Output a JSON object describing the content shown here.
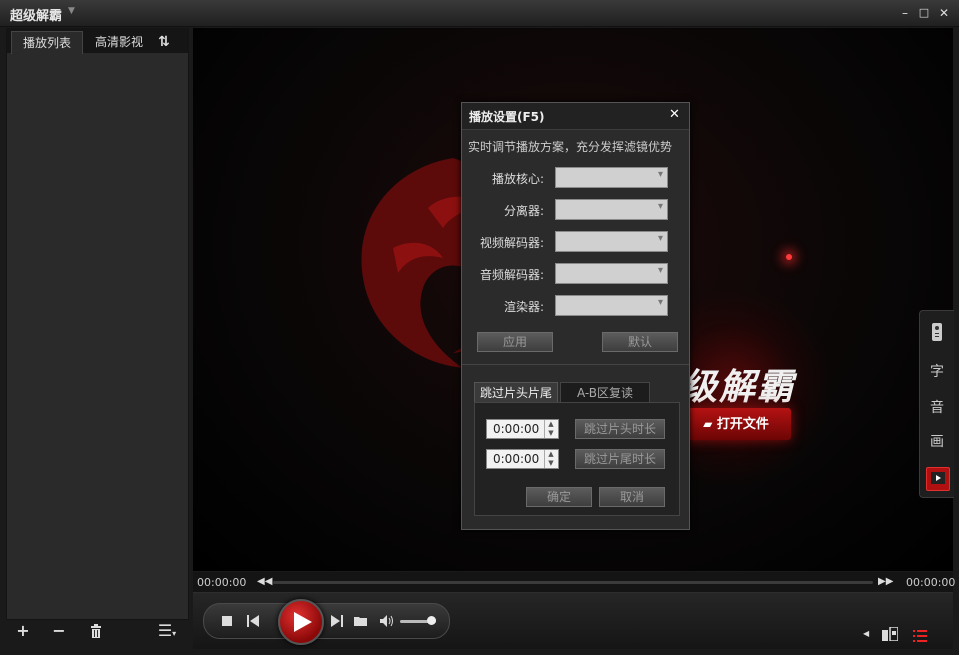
{
  "app": {
    "title": "超级解霸"
  },
  "window": {
    "minimize": "–",
    "maximize": "□",
    "close": "✕"
  },
  "sidebar": {
    "tabs": [
      {
        "label": "播放列表"
      },
      {
        "label": "高清影视"
      }
    ],
    "refresh_icon": "refresh-icon",
    "bottom": {
      "add": "+",
      "remove": "−",
      "delete_icon": "trash-icon",
      "menu": "☰"
    }
  },
  "video": {
    "brand_text": "级解霸",
    "open_file_label": "打开文件"
  },
  "right_rail": {
    "items": [
      {
        "name": "remote-icon",
        "label": ""
      },
      {
        "name": "subtitle",
        "label": "字"
      },
      {
        "name": "audio",
        "label": "音"
      },
      {
        "name": "screen",
        "label": "画"
      },
      {
        "name": "play-media-icon",
        "label": ""
      }
    ]
  },
  "dialog": {
    "title": "播放设置(F5)",
    "description": "实时调节播放方案，充分发挥滤镜优势",
    "fields": [
      {
        "label": "播放核心:",
        "value": ""
      },
      {
        "label": "分离器:",
        "value": ""
      },
      {
        "label": "视频解码器:",
        "value": ""
      },
      {
        "label": "音频解码器:",
        "value": ""
      },
      {
        "label": "渲染器:",
        "value": ""
      }
    ],
    "apply_label": "应用",
    "default_label": "默认",
    "tabs": [
      {
        "label": "跳过片头片尾"
      },
      {
        "label": "A-B区复读"
      }
    ],
    "skip_head_time": "0:00:00",
    "skip_tail_time": "0:00:00",
    "skip_head_label": "跳过片头时长",
    "skip_tail_label": "跳过片尾时长",
    "confirm_label": "确定",
    "cancel_label": "取消"
  },
  "seek": {
    "current_time": "00:00:00",
    "total_time": "00:00:00",
    "progress": 0
  },
  "controls": {
    "volume_level": 0.85
  }
}
